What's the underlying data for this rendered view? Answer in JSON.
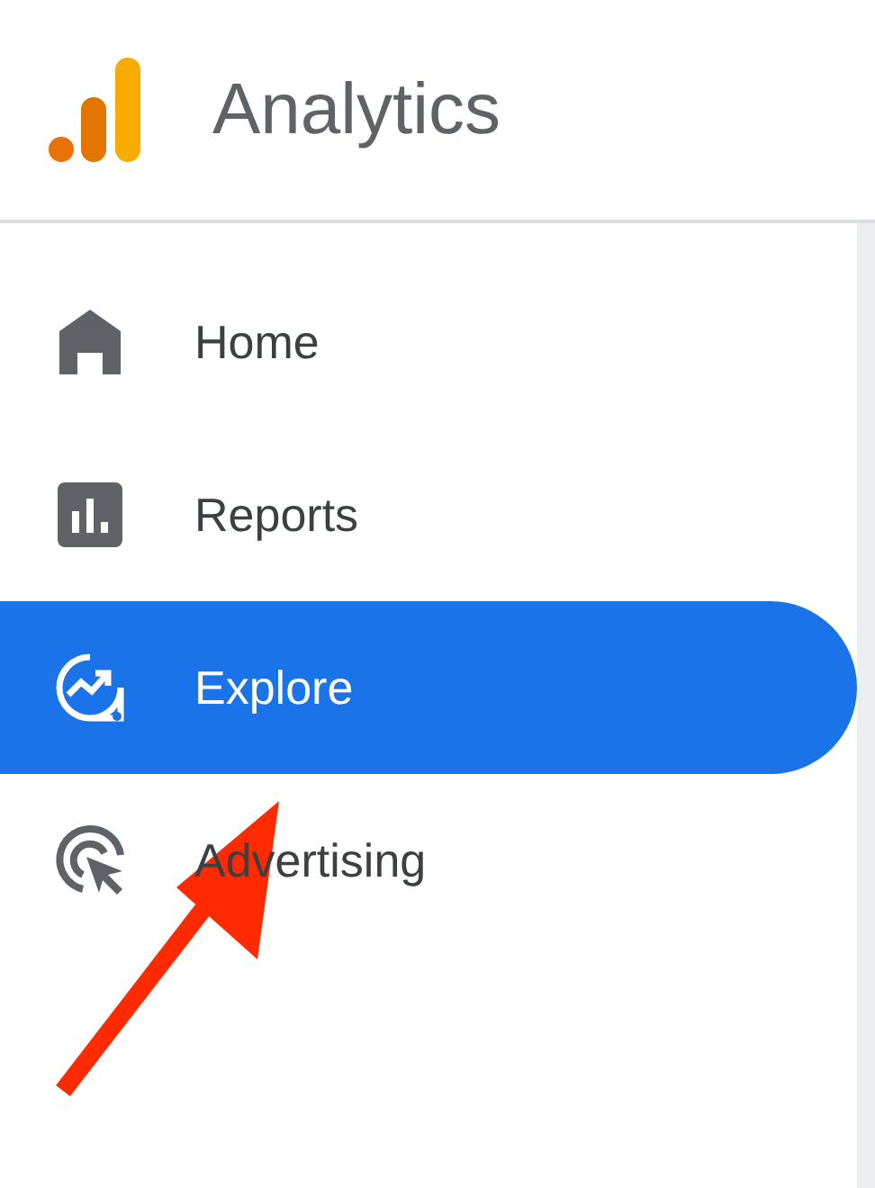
{
  "header": {
    "title": "Analytics"
  },
  "nav": {
    "items": [
      {
        "label": "Home",
        "selected": false
      },
      {
        "label": "Reports",
        "selected": false
      },
      {
        "label": "Explore",
        "selected": true
      },
      {
        "label": "Advertising",
        "selected": false
      }
    ]
  }
}
